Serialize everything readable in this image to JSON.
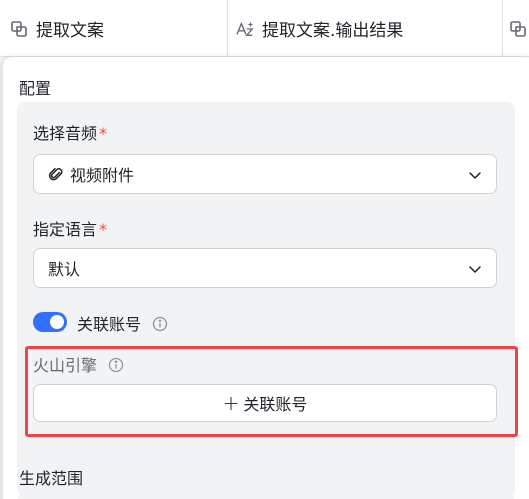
{
  "columns": [
    {
      "label": "提取文案",
      "icon": "lookup-icon"
    },
    {
      "label": "提取文案.输出结果",
      "icon": "ai-text-icon"
    },
    {
      "label": "",
      "icon": "lookup-icon"
    }
  ],
  "panel": {
    "title": "配置",
    "audio": {
      "label": "选择音频",
      "required_mark": "*",
      "value": "视频附件",
      "value_icon": "paperclip-icon"
    },
    "language": {
      "label": "指定语言",
      "required_mark": "*",
      "value": "默认"
    },
    "link_account_toggle": {
      "label": "关联账号",
      "enabled": true
    },
    "engine": {
      "label": "火山引擎",
      "button_label": "关联账号",
      "button_prefix": "+"
    },
    "generate_range": {
      "label": "生成范围"
    }
  },
  "colors": {
    "accent": "#3370ff",
    "required": "#f54a45",
    "highlight": "#ef4444"
  }
}
